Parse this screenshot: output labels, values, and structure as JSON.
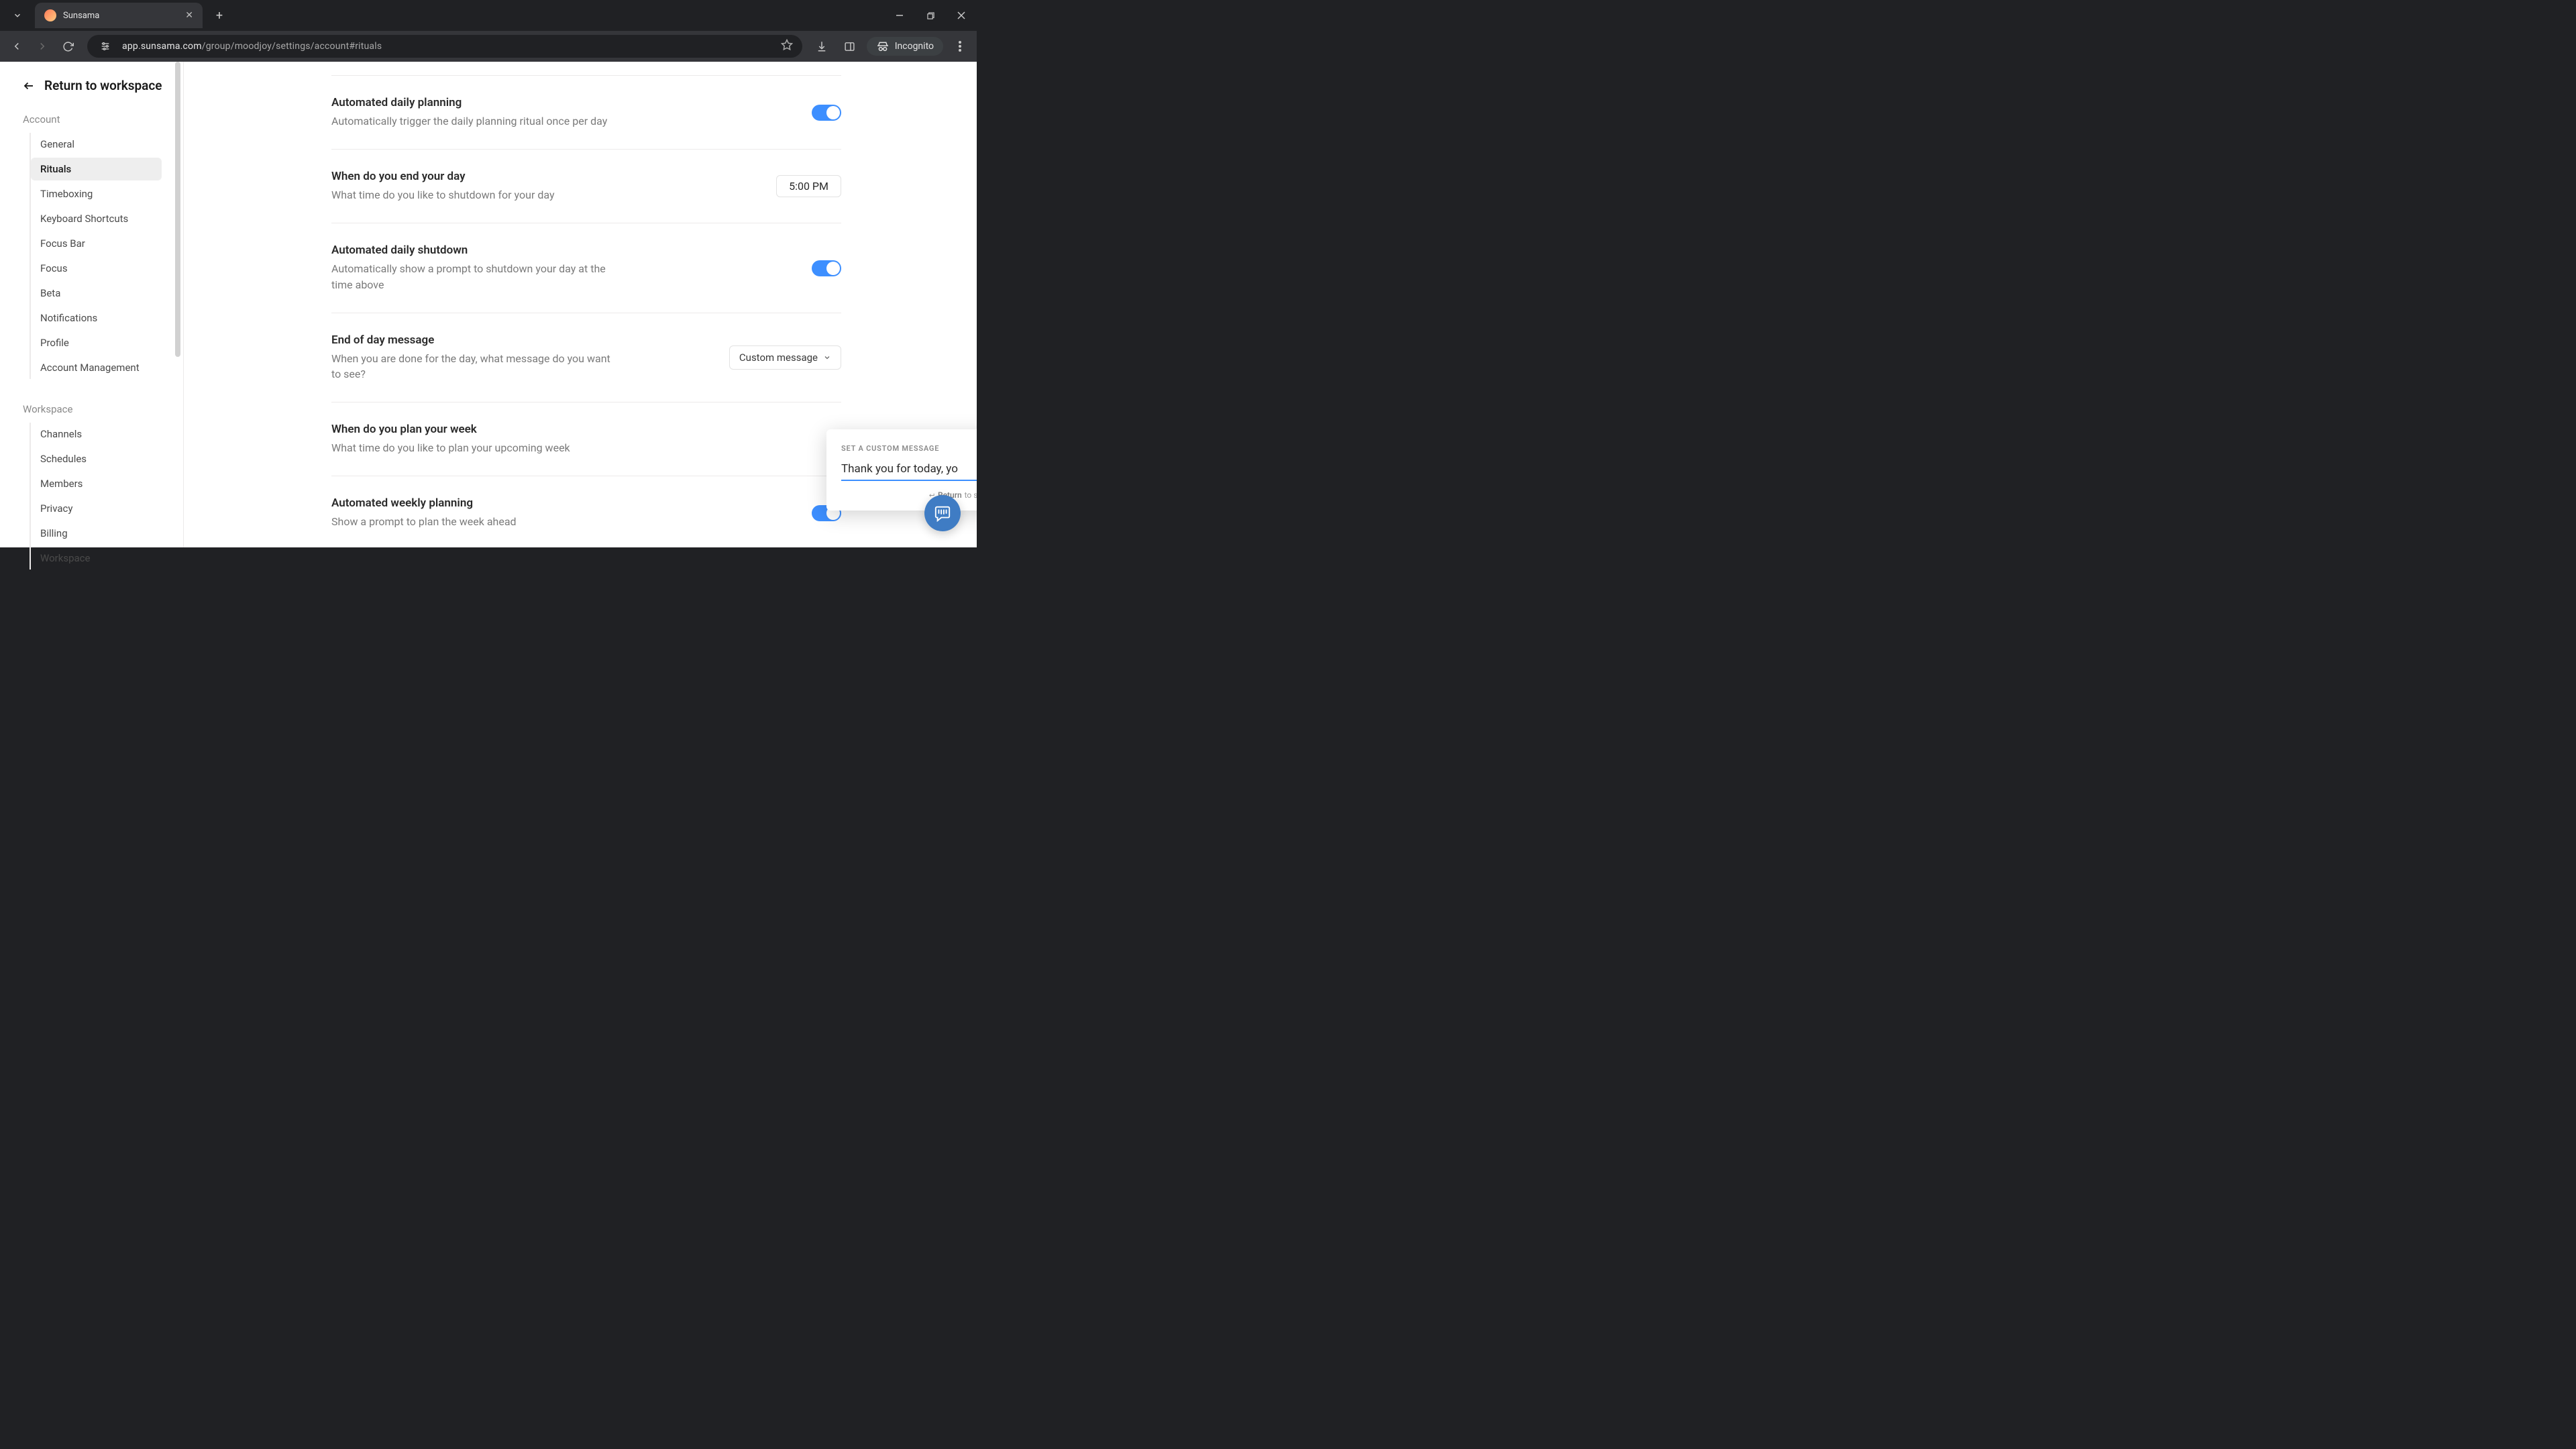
{
  "browser": {
    "tab_title": "Sunsama",
    "url_host": "app.sunsama.com",
    "url_path": "/group/moodjoy/settings/account#rituals",
    "incognito_label": "Incognito"
  },
  "sidebar": {
    "return_label": "Return to workspace",
    "sections": {
      "account": {
        "label": "Account",
        "items": [
          {
            "label": "General"
          },
          {
            "label": "Rituals",
            "active": true
          },
          {
            "label": "Timeboxing"
          },
          {
            "label": "Keyboard Shortcuts"
          },
          {
            "label": "Focus Bar"
          },
          {
            "label": "Focus"
          },
          {
            "label": "Beta"
          },
          {
            "label": "Notifications"
          },
          {
            "label": "Profile"
          },
          {
            "label": "Account Management"
          }
        ]
      },
      "workspace": {
        "label": "Workspace",
        "items": [
          {
            "label": "Channels"
          },
          {
            "label": "Schedules"
          },
          {
            "label": "Members"
          },
          {
            "label": "Privacy"
          },
          {
            "label": "Billing"
          },
          {
            "label": "Workspace"
          }
        ]
      }
    }
  },
  "settings": {
    "rows": [
      {
        "title": "Automated daily planning",
        "sub": "Automatically trigger the daily planning ritual once per day",
        "control": "toggle_on"
      },
      {
        "title": "When do you end your day",
        "sub": "What time do you like to shutdown for your day",
        "control": "time",
        "value": "5:00 PM"
      },
      {
        "title": "Automated daily shutdown",
        "sub": "Automatically show a prompt to shutdown your day at the time above",
        "control": "toggle_on"
      },
      {
        "title": "End of day message",
        "sub": "When you are done for the day, what message do you want to see?",
        "control": "select",
        "value": "Custom message"
      },
      {
        "title": "When do you plan your week",
        "sub": "What time do you like to plan your upcoming week",
        "control": "none"
      },
      {
        "title": "Automated weekly planning",
        "sub": "Show a prompt to plan the week ahead",
        "control": "toggle_on"
      }
    ]
  },
  "popover": {
    "heading": "SET A CUSTOM MESSAGE",
    "value": "Thank you for today, yo",
    "hint_key": "Return",
    "hint_rest": " to save"
  }
}
